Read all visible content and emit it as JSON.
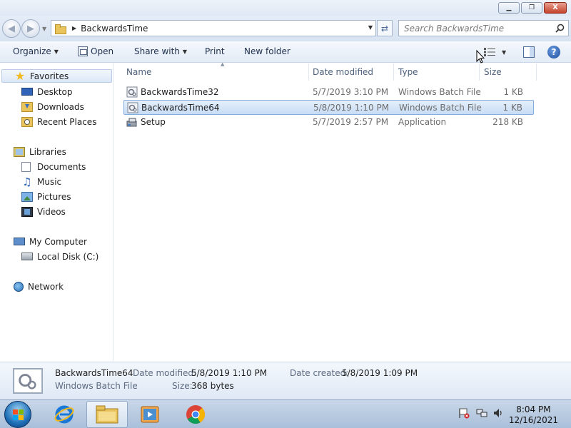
{
  "window": {
    "minimize_glyph": "▁",
    "maximize_glyph": "❐",
    "close_glyph": "X"
  },
  "address": {
    "breadcrumb": "BackwardsTime",
    "search_placeholder": "Search BackwardsTime"
  },
  "toolbar": {
    "organize": "Organize",
    "open": "Open",
    "share_with": "Share with",
    "print": "Print",
    "new_folder": "New folder"
  },
  "sidebar": {
    "favorites": "Favorites",
    "desktop": "Desktop",
    "downloads": "Downloads",
    "recent_places": "Recent Places",
    "libraries": "Libraries",
    "documents": "Documents",
    "music": "Music",
    "pictures": "Pictures",
    "videos": "Videos",
    "my_computer": "My Computer",
    "local_disk": "Local Disk (C:)",
    "network": "Network"
  },
  "columns": {
    "name": "Name",
    "date_modified": "Date modified",
    "type": "Type",
    "size": "Size"
  },
  "files": [
    {
      "name": "BackwardsTime32",
      "date": "5/7/2019 3:10 PM",
      "type": "Windows Batch File",
      "size": "1 KB",
      "selected": false
    },
    {
      "name": "BackwardsTime64",
      "date": "5/8/2019 1:10 PM",
      "type": "Windows Batch File",
      "size": "1 KB",
      "selected": true
    },
    {
      "name": "Setup",
      "date": "5/7/2019 2:57 PM",
      "type": "Application",
      "size": "218 KB",
      "selected": false
    }
  ],
  "details": {
    "filename": "BackwardsTime64",
    "file_type": "Windows Batch File",
    "date_modified_label": "Date modified:",
    "date_modified_value": "5/8/2019 1:10 PM",
    "size_label": "Size:",
    "size_value": "368 bytes",
    "date_created_label": "Date created:",
    "date_created_value": "5/8/2019 1:09 PM"
  },
  "taskbar": {
    "time": "8:04 PM",
    "date": "12/16/2021"
  },
  "colors": {
    "selection_fill": "#cfe0f5",
    "selection_border": "#84acdd",
    "link_blue": "#1e2f4d"
  }
}
